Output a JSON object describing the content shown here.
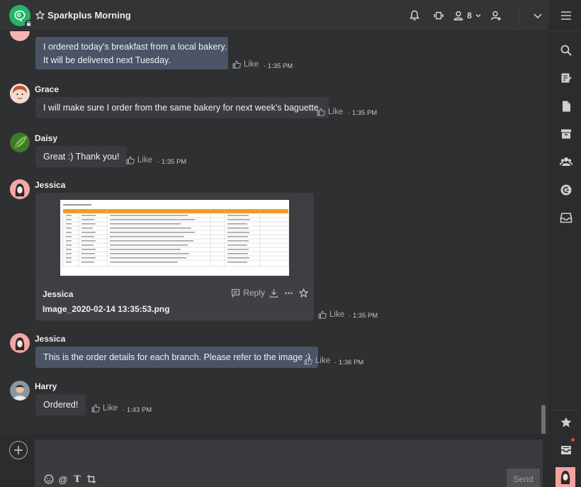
{
  "header": {
    "room_title": "Sparkplus Morning",
    "member_count": "8"
  },
  "messages": [
    {
      "id": "m1",
      "sender": "",
      "text_line1": "I ordered today's breakfast from a local bakery.",
      "text_line2": "It will be delivered next Tuesday.",
      "like_label": "Like",
      "time": "1:35 PM"
    },
    {
      "id": "m2",
      "sender": "Grace",
      "text": "I will make sure I order from the same bakery for next week's baguette.",
      "like_label": "Like",
      "time": "1:35 PM"
    },
    {
      "id": "m3",
      "sender": "Daisy",
      "text": "Great :) Thank you!",
      "like_label": "Like",
      "time": "1:35 PM"
    },
    {
      "id": "m4",
      "sender": "Jessica",
      "file_uploader": "Jessica",
      "file_name": "Image_2020-02-14 13:35:53.png",
      "reply_label": "Reply",
      "like_label": "Like",
      "time": "1:35 PM"
    },
    {
      "id": "m5",
      "sender": "Jessica",
      "text": "This is the order details for each branch. Please refer to the image :)",
      "like_label": "Like",
      "time": "1:36 PM"
    },
    {
      "id": "m6",
      "sender": "Harry",
      "text": "Ordered!",
      "like_label": "Like",
      "time": "1:43 PM"
    }
  ],
  "composer": {
    "placeholder": "",
    "send_label": "Send"
  },
  "colors": {
    "accent_room": "#26b36a",
    "bubble_self": "#4a5466",
    "bubble_other": "#393b3e",
    "notification_dot": "#e8443a"
  },
  "icons": [
    "notification-bell-icon",
    "video-call-icon",
    "members-icon",
    "invite-user-icon",
    "chevron-down-icon",
    "menu-icon",
    "search-icon",
    "notes-icon",
    "files-icon",
    "archive-icon",
    "users-icon",
    "connect-icon",
    "drawer-icon",
    "star-icon",
    "inbox-icon"
  ]
}
